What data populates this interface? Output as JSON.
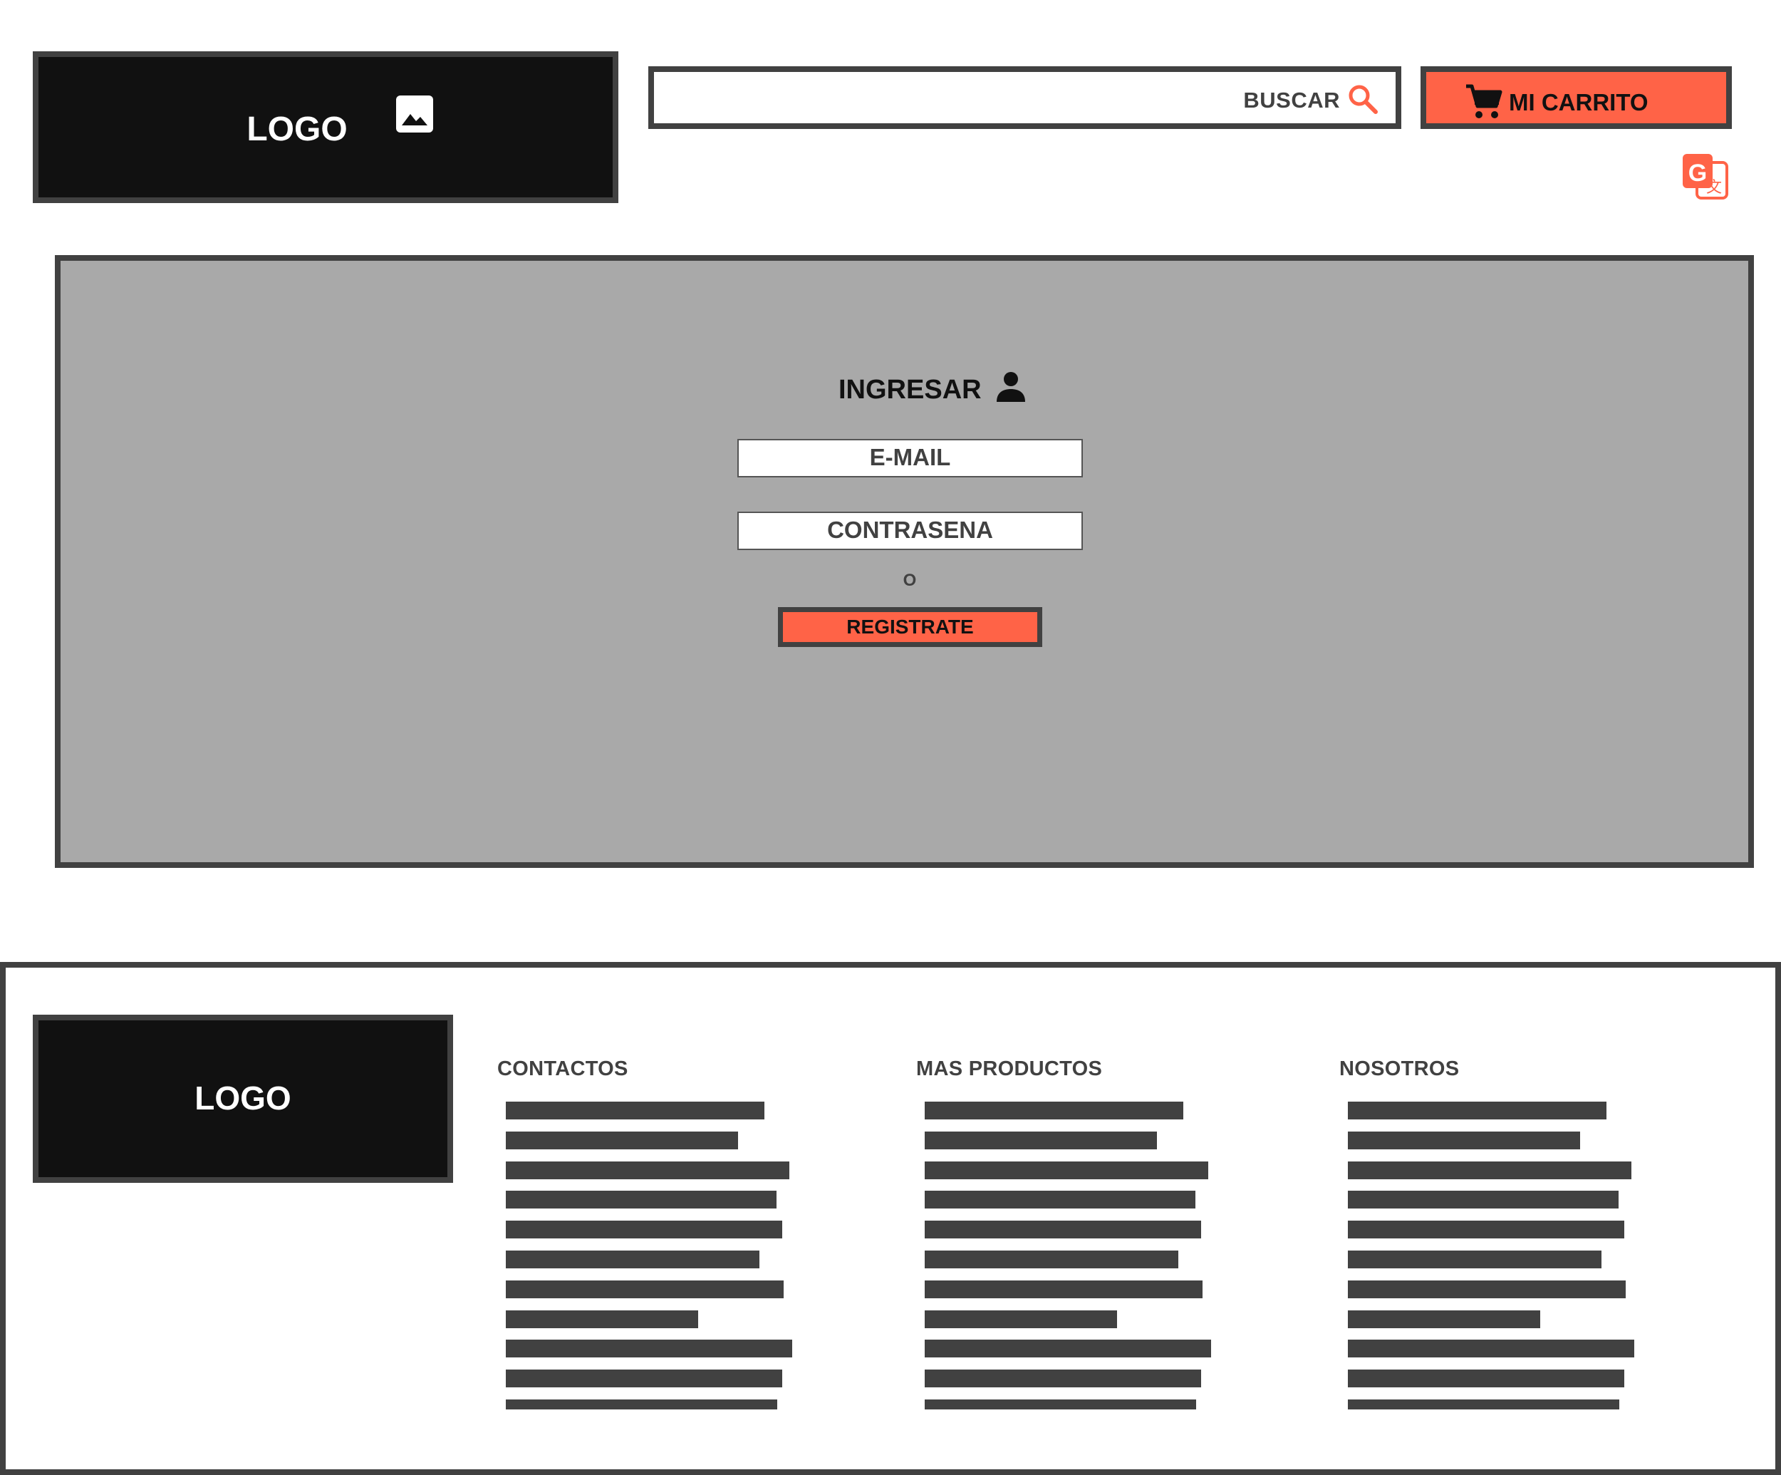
{
  "header": {
    "logo_text": "LOGO",
    "logo_icon": "image-icon",
    "search": {
      "label": "BUSCAR",
      "icon": "search-icon",
      "value": ""
    },
    "cart": {
      "label": "MI CARRITO",
      "icon": "cart-icon"
    },
    "translate_icon": "translate-icon"
  },
  "login": {
    "title": "INGRESAR",
    "title_icon": "user-icon",
    "email_label": "E-MAIL",
    "password_label": "CONTRASENA",
    "or_text": "O",
    "register_label": "REGISTRATE"
  },
  "footer": {
    "logo_text": "LOGO",
    "columns": [
      {
        "title": "CONTACTOS"
      },
      {
        "title": "MAS PRODUCTOS"
      },
      {
        "title": "NOSOTROS"
      }
    ]
  },
  "colors": {
    "accent": "#ff6347",
    "dark": "#111111",
    "border": "#414141",
    "panel": "#a9a9a9"
  }
}
